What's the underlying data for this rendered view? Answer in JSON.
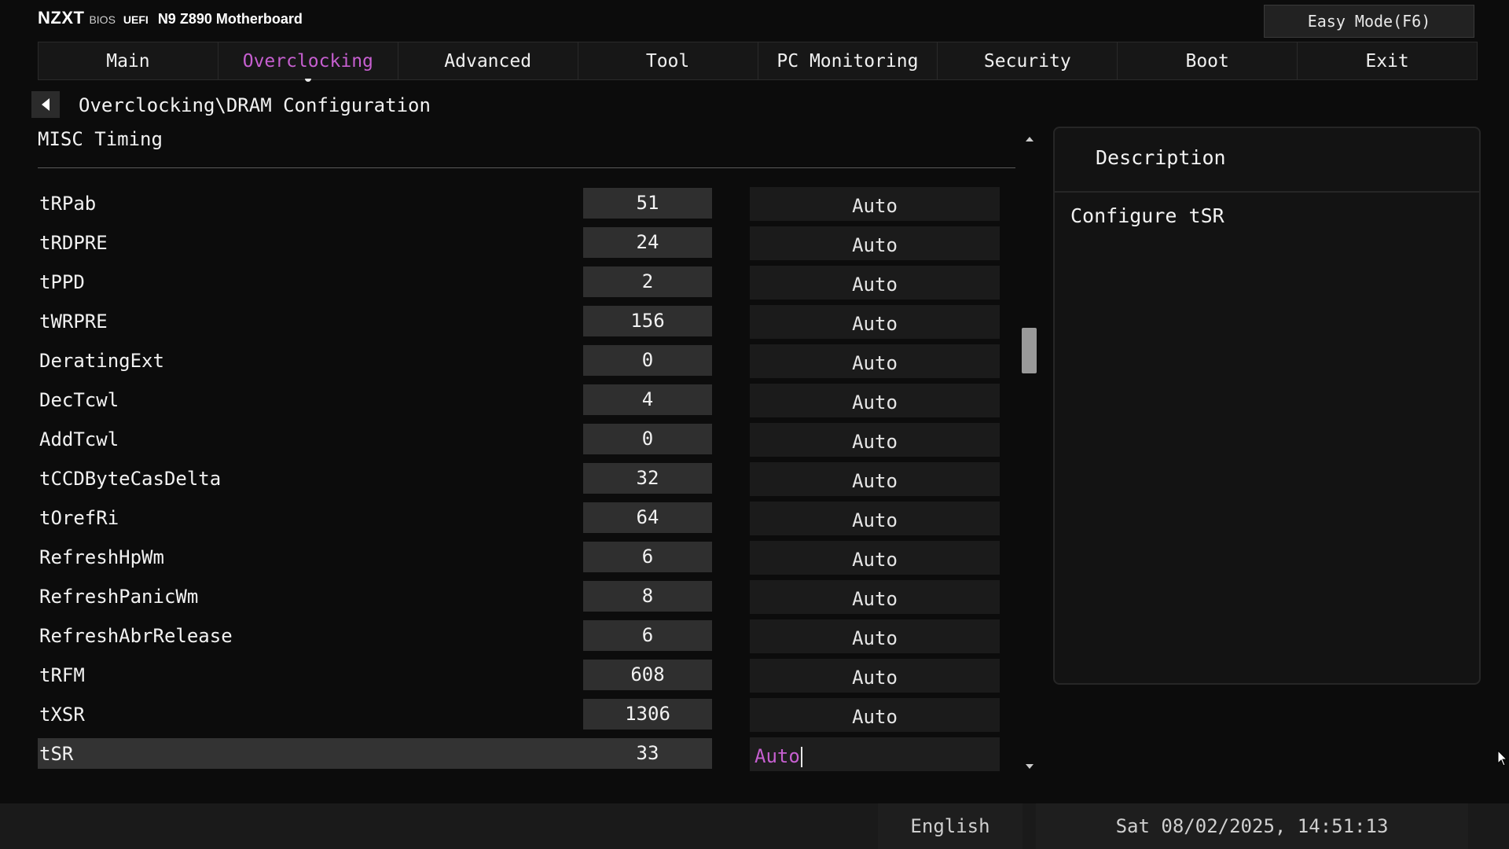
{
  "header": {
    "brand_logo": "NZXT",
    "brand_bios": "BIOS",
    "brand_uefi": "UEFI",
    "model": "N9 Z890 Motherboard",
    "easy_mode_label": "Easy Mode(F6)"
  },
  "tabs": [
    {
      "label": "Main"
    },
    {
      "label": "Overclocking",
      "active": true
    },
    {
      "label": "Advanced"
    },
    {
      "label": "Tool"
    },
    {
      "label": "PC Monitoring"
    },
    {
      "label": "Security"
    },
    {
      "label": "Boot"
    },
    {
      "label": "Exit"
    }
  ],
  "breadcrumb": "Overclocking\\DRAM Configuration",
  "section_title": "MISC Timing",
  "rows": [
    {
      "label": "tRPab",
      "value": "51",
      "mode": "Auto"
    },
    {
      "label": "tRDPRE",
      "value": "24",
      "mode": "Auto"
    },
    {
      "label": "tPPD",
      "value": "2",
      "mode": "Auto"
    },
    {
      "label": "tWRPRE",
      "value": "156",
      "mode": "Auto"
    },
    {
      "label": "DeratingExt",
      "value": "0",
      "mode": "Auto"
    },
    {
      "label": "DecTcwl",
      "value": "4",
      "mode": "Auto"
    },
    {
      "label": "AddTcwl",
      "value": "0",
      "mode": "Auto"
    },
    {
      "label": "tCCDByteCasDelta",
      "value": "32",
      "mode": "Auto"
    },
    {
      "label": "tOrefRi",
      "value": "64",
      "mode": "Auto"
    },
    {
      "label": "RefreshHpWm",
      "value": "6",
      "mode": "Auto"
    },
    {
      "label": "RefreshPanicWm",
      "value": "8",
      "mode": "Auto"
    },
    {
      "label": "RefreshAbrRelease",
      "value": "6",
      "mode": "Auto"
    },
    {
      "label": "tRFM",
      "value": "608",
      "mode": "Auto"
    },
    {
      "label": "tXSR",
      "value": "1306",
      "mode": "Auto"
    },
    {
      "label": "tSR",
      "value": "33",
      "mode": "Auto",
      "selected": true
    }
  ],
  "description": {
    "title": "Description",
    "text": "Configure tSR"
  },
  "footer": {
    "language": "English",
    "datetime": "Sat 08/02/2025, 14:51:13"
  },
  "colors": {
    "accent": "#c65fd0",
    "background": "#0c0c0c"
  }
}
